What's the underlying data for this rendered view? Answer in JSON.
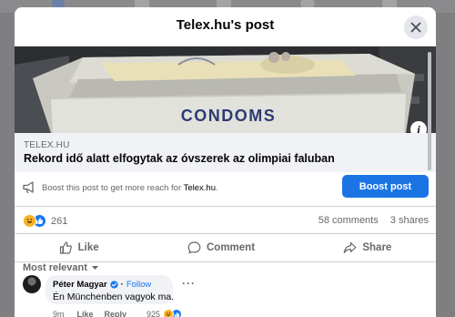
{
  "modal": {
    "title": "Telex.hu's post",
    "close_icon": "close-icon"
  },
  "preview": {
    "box_text": "CONDOMS",
    "info_icon": "info-icon"
  },
  "link": {
    "domain": "TELEX.HU",
    "title": "Rekord idő alatt elfogytak az óvszerek az olimpiai faluban"
  },
  "boost": {
    "text_prefix": "Boost this post to get more reach for ",
    "page_name": "Telex.hu",
    "text_suffix": ".",
    "button_label": "Boost post",
    "icon": "megaphone-icon"
  },
  "stats": {
    "reaction_count": "261",
    "comments": "58 comments",
    "shares": "3 shares",
    "reaction_icons": [
      "haha-icon",
      "like-icon"
    ]
  },
  "actions": {
    "like": "Like",
    "comment": "Comment",
    "share": "Share"
  },
  "sort": {
    "label": "Most relevant"
  },
  "comment": {
    "author": "Péter Magyar",
    "follow": "Follow",
    "text": "Én Münchenben vagyok ma.",
    "time": "9m",
    "like": "Like",
    "reply": "Reply",
    "reaction_count": "925"
  },
  "colors": {
    "accent": "#1b74e4",
    "secondary_text": "#65676b",
    "surface": "#f0f2f5"
  }
}
